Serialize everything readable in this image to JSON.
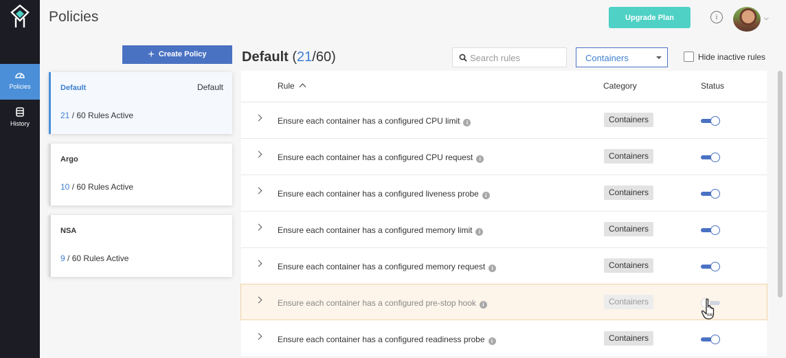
{
  "app": {
    "page_title": "Policies",
    "upgrade_label": "Upgrade Plan",
    "info_icon": "info-icon",
    "colors": {
      "accent": "#4a72c2",
      "link": "#3f7fd0",
      "upgrade": "#4fd1c5",
      "sidebar": "#1c1c24",
      "active_nav": "#4a8fd8"
    }
  },
  "nav": [
    {
      "label": "Policies",
      "icon": "gauge-icon",
      "active": true
    },
    {
      "label": "History",
      "icon": "database-icon",
      "active": false
    }
  ],
  "create_policy_label": "Create Policy",
  "policies": [
    {
      "name": "Default",
      "tag": "Default",
      "active_count": "21",
      "rules_suffix": " / 60 Rules Active",
      "selected": true
    },
    {
      "name": "Argo",
      "tag": "",
      "active_count": "10",
      "rules_suffix": " / 60 Rules Active",
      "selected": false
    },
    {
      "name": "NSA",
      "tag": "",
      "active_count": "9",
      "rules_suffix": " / 60 Rules Active",
      "selected": false
    }
  ],
  "panel": {
    "title": "Default",
    "open_paren": "(",
    "active": "21",
    "total": "/60)",
    "search_placeholder": "Search rules",
    "category_filter": "Containers",
    "hide_inactive_label": "Hide inactive rules",
    "hide_inactive_checked": false
  },
  "table": {
    "headers": {
      "rule": "Rule",
      "category": "Category",
      "status": "Status"
    },
    "rows": [
      {
        "rule": "Ensure each container has a configured CPU limit",
        "category": "Containers",
        "enabled": true
      },
      {
        "rule": "Ensure each container has a configured CPU request",
        "category": "Containers",
        "enabled": true
      },
      {
        "rule": "Ensure each container has a configured liveness probe",
        "category": "Containers",
        "enabled": true
      },
      {
        "rule": "Ensure each container has a configured memory limit",
        "category": "Containers",
        "enabled": true
      },
      {
        "rule": "Ensure each container has a configured memory request",
        "category": "Containers",
        "enabled": true
      },
      {
        "rule": "Ensure each container has a configured pre-stop hook",
        "category": "Containers",
        "enabled": false,
        "hovered": true
      },
      {
        "rule": "Ensure each container has a configured readiness probe",
        "category": "Containers",
        "enabled": true
      }
    ]
  }
}
